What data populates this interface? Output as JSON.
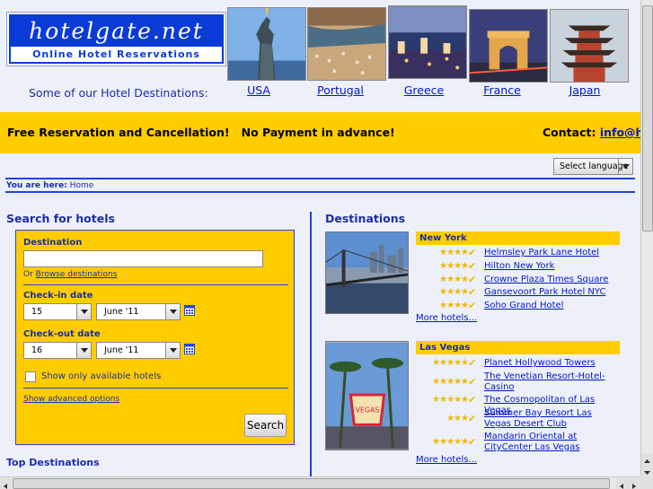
{
  "header": {
    "logo_title": "hotelgate.net",
    "logo_subtitle": "Online Hotel Reservations",
    "tagline": "Some of our Hotel Destinations:",
    "featured": [
      {
        "label": "USA"
      },
      {
        "label": "Portugal"
      },
      {
        "label": "Greece"
      },
      {
        "label": "France"
      },
      {
        "label": "Japan"
      }
    ]
  },
  "banner": {
    "text": "Free Reservation and Cancellation!   No Payment in advance!",
    "contact_label": "Contact:",
    "contact_link": "info@ho"
  },
  "language": {
    "selected": "Select language"
  },
  "breadcrumb": {
    "prefix": "You are here:",
    "current": "Home"
  },
  "search": {
    "title": "Search for hotels",
    "destination_label": "Destination",
    "destination_value": "",
    "or_text": "Or",
    "browse_link": "Browse destinations",
    "checkin_label": "Check-in date",
    "checkin_day": "15",
    "checkin_month": "June '11",
    "checkout_label": "Check-out date",
    "checkout_day": "16",
    "checkout_month": "June '11",
    "available_label": "Show only available hotels",
    "advanced_link": "Show advanced options",
    "button": "Search"
  },
  "top_destinations": {
    "title": "Top Destinations"
  },
  "destinations": {
    "title": "Destinations",
    "cities": [
      {
        "name": "New York",
        "more": "More hotels...",
        "hotels": [
          {
            "name": "Helmsley Park Lane Hotel",
            "stars": 4
          },
          {
            "name": "Hilton New York",
            "stars": 4
          },
          {
            "name": "Crowne Plaza Times Square",
            "stars": 4
          },
          {
            "name": "Gansevoort Park Hotel NYC",
            "stars": 4
          },
          {
            "name": "Soho Grand Hotel",
            "stars": 4
          }
        ]
      },
      {
        "name": "Las Vegas",
        "more": "More hotels...",
        "hotels": [
          {
            "name": "Planet Hollywood Towers",
            "stars": 5
          },
          {
            "name": "The Venetian Resort-Hotel-Casino",
            "stars": 5
          },
          {
            "name": "The Cosmopolitan of Las Vegas",
            "stars": 5
          },
          {
            "name": "Summer Bay Resort Las Vegas Desert Club",
            "stars": 3
          },
          {
            "name": "Mandarin Oriental at CityCenter Las Vegas",
            "stars": 5
          }
        ]
      }
    ]
  },
  "colors": {
    "accent_yellow": "#ffcc00",
    "brand_blue": "#0b3bd6",
    "link_blue": "#0018c8"
  }
}
